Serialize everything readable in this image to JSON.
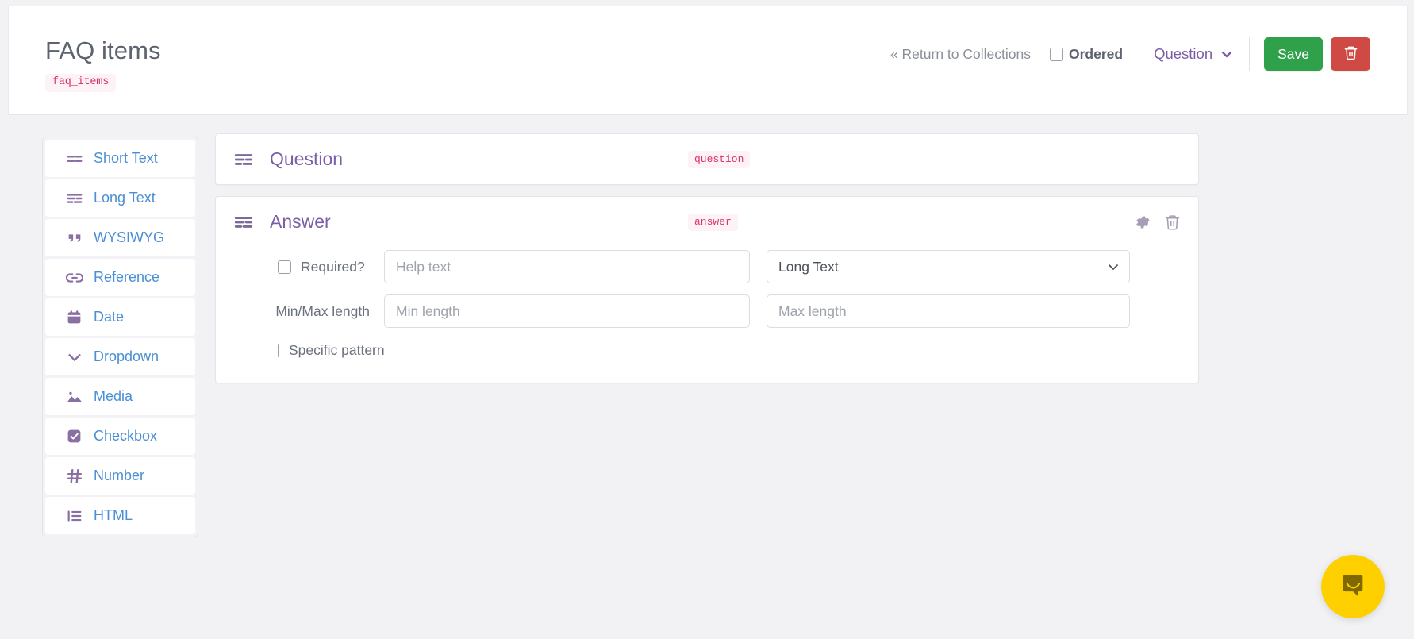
{
  "header": {
    "title": "FAQ items",
    "collection_code": "faq_items",
    "return_link": "« Return to Collections",
    "ordered_label": "Ordered",
    "ordered_checked": false,
    "field_selector_label": "Question",
    "save_label": "Save",
    "delete_icon": "trash-icon",
    "save_color": "#2fa14b",
    "delete_color": "#cf4a45",
    "accent_purple": "#7b5ea7",
    "code_badge_color": "#d6336c"
  },
  "sidebar": {
    "items": [
      {
        "label": "Short Text",
        "icon": "short-text-icon"
      },
      {
        "label": "Long Text",
        "icon": "long-text-icon"
      },
      {
        "label": "WYSIWYG",
        "icon": "quote-icon"
      },
      {
        "label": "Reference",
        "icon": "link-icon"
      },
      {
        "label": "Date",
        "icon": "calendar-icon"
      },
      {
        "label": "Dropdown",
        "icon": "chevron-down-icon"
      },
      {
        "label": "Media",
        "icon": "image-icon"
      },
      {
        "label": "Checkbox",
        "icon": "checkbox-icon"
      },
      {
        "label": "Number",
        "icon": "hash-icon"
      },
      {
        "label": "HTML",
        "icon": "list-icon"
      }
    ]
  },
  "fields": [
    {
      "title": "Question",
      "code": "question",
      "icon": "long-text-icon",
      "expanded": false
    },
    {
      "title": "Answer",
      "code": "answer",
      "icon": "long-text-icon",
      "expanded": true,
      "settings_icon": "gear-icon",
      "delete_icon": "trash-icon",
      "required_label": "Required?",
      "required_checked": false,
      "help_text_placeholder": "Help text",
      "help_text_value": "",
      "type_value": "Long Text",
      "type_options": [
        "Short Text",
        "Long Text",
        "WYSIWYG",
        "Reference",
        "Date",
        "Dropdown",
        "Media",
        "Checkbox",
        "Number",
        "HTML"
      ],
      "minmax_label": "Min/Max length",
      "min_placeholder": "Min length",
      "min_value": "",
      "max_placeholder": "Max length",
      "max_value": "",
      "pattern_label": "Specific pattern",
      "pattern_checked": false
    }
  ],
  "chat": {
    "icon": "chat-bubble-icon",
    "color": "#ffd000"
  }
}
